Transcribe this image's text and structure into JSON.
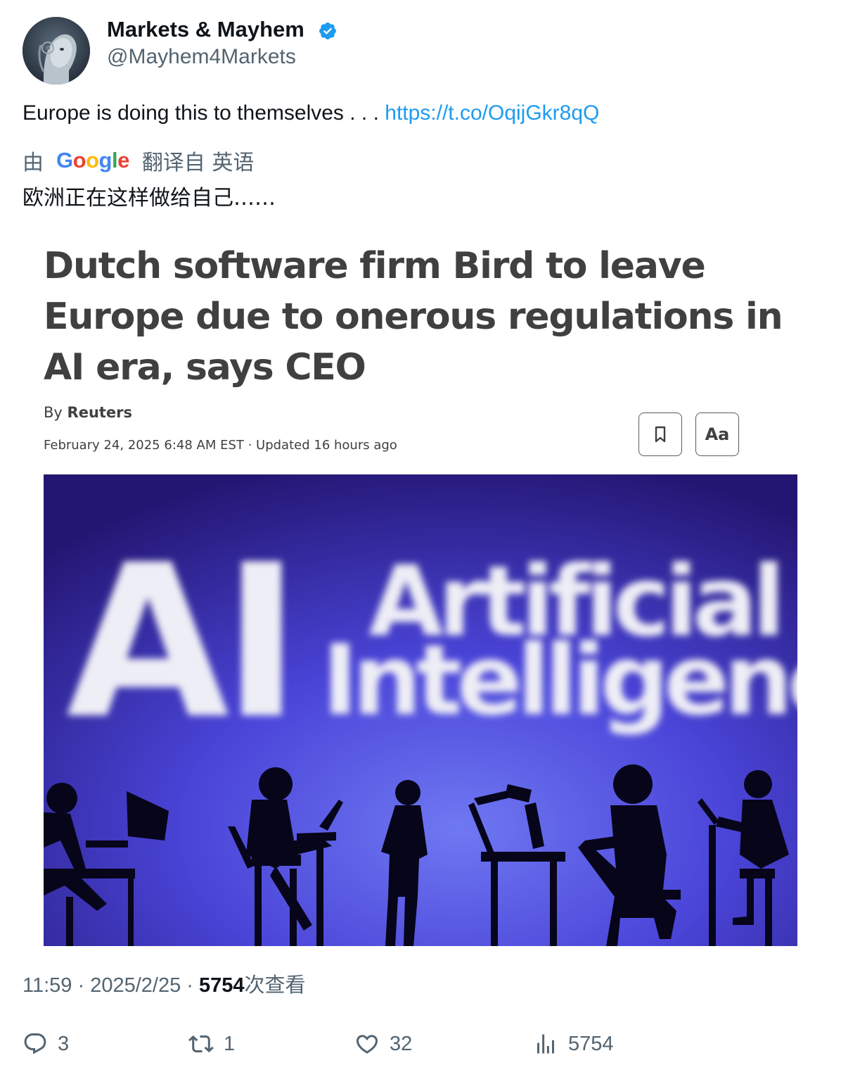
{
  "author": {
    "display_name": "Markets & Mayhem",
    "handle": "@Mayhem4Markets",
    "avatar_icon": "robot-avatar",
    "verified_icon": "verified-badge-icon"
  },
  "tweet": {
    "text": "Europe is doing this to themselves . . . ",
    "link": "https://t.co/OqijGkr8qQ"
  },
  "translation": {
    "prefix": "由",
    "provider": "Google",
    "suffix": "翻译自 英语",
    "text": "欧洲正在这样做给自己……"
  },
  "article": {
    "headline": "Dutch software firm Bird to leave Europe due to onerous regulations in AI era, says CEO",
    "byline_prefix": "By",
    "byline_source": "Reuters",
    "dateline": "February 24, 2025 6:48 AM EST · Updated 16 hours ago",
    "font_button_label": "Aa",
    "photo": {
      "big_text": "AI",
      "line1": "Artificial",
      "line2": "Intelligence"
    }
  },
  "meta": {
    "time": "11:59",
    "sep1": " · ",
    "date": "2025/2/25",
    "sep2": " · ",
    "views": "5754",
    "views_label": "次查看"
  },
  "actions": {
    "replies": "3",
    "retweets": "1",
    "likes": "32",
    "views": "5754"
  },
  "colors": {
    "link": "#1d9bf0",
    "secondary_text": "#536471",
    "verified": "#1d9bf0"
  }
}
